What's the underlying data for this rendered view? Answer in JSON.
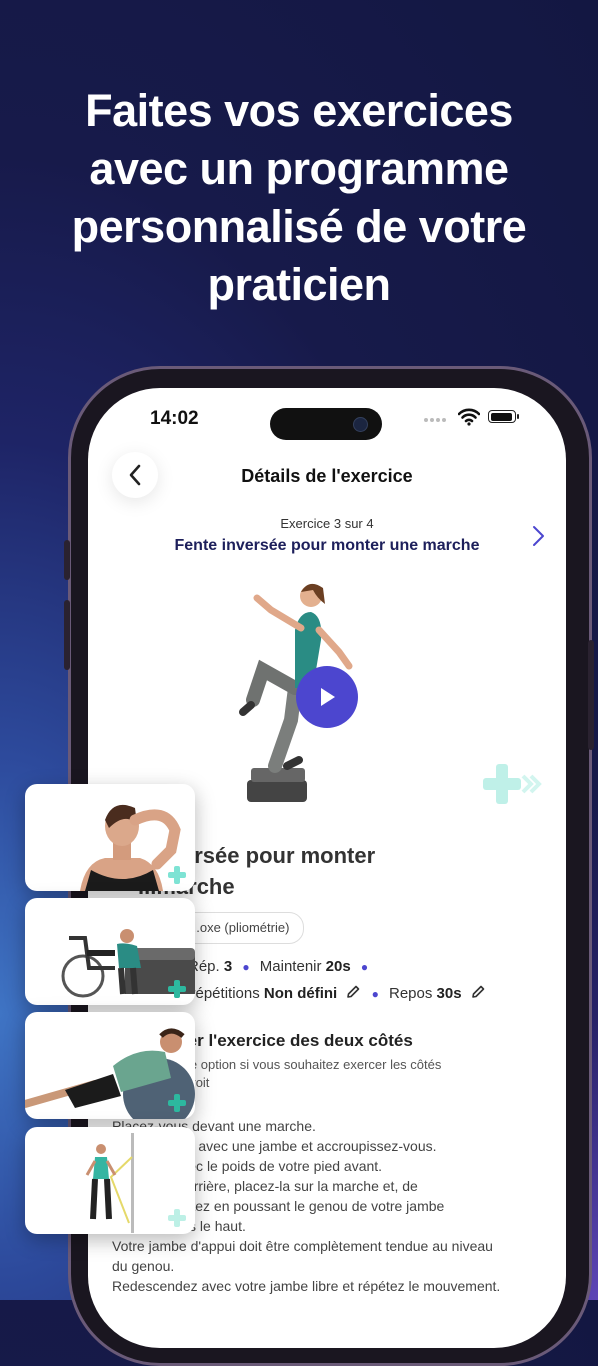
{
  "promo": {
    "headline": [
      "Faites vos exercices",
      "avec un programme",
      "personnalisé de votre",
      "praticien"
    ]
  },
  "status_bar": {
    "time": "14:02"
  },
  "nav": {
    "title": "Détails de l'exercice"
  },
  "exercise": {
    "counter": "Exercice 3 sur 4",
    "name": "Fente inversée pour monter une marche",
    "title_line1": "...nversée pour monter",
    "title_line2": "...marche",
    "tag": "...oxe (pliométrie)",
    "params": {
      "reps_label": "Rép.",
      "reps_value": "3",
      "hold_label": "Maintenir",
      "hold_value": "20s",
      "sets_label": "...répétitions",
      "sets_value": "Non défini",
      "rest_label": "Repos",
      "rest_value": "30s"
    },
    "both_sides": {
      "title": "...ctuer l'exercice des deux côtés",
      "description_line1": "...z cette option si vous souhaitez exercer les côtés",
      "description_line2": "...e et droit"
    },
    "instructions": [
      "Placez-vous devant une marche.",
      "...s en arrière avec une jambe et accroupissez-vous.",
      "... le haut avec le poids de votre pied avant.",
      "...tre jambe arrière, placez-la sur la marche et, de",
      "...osive, montez en poussant le genou de votre jambe",
      "...vant et vers le haut.",
      "Votre jambe d'appui doit être complètement tendue au niveau",
      "du genou.",
      "Redescendez avec votre jambe libre et répétez le mouvement."
    ]
  },
  "colors": {
    "accent": "#4c46cf",
    "navy": "#1d1f5b",
    "deco_plus": "#7ee3d4"
  }
}
